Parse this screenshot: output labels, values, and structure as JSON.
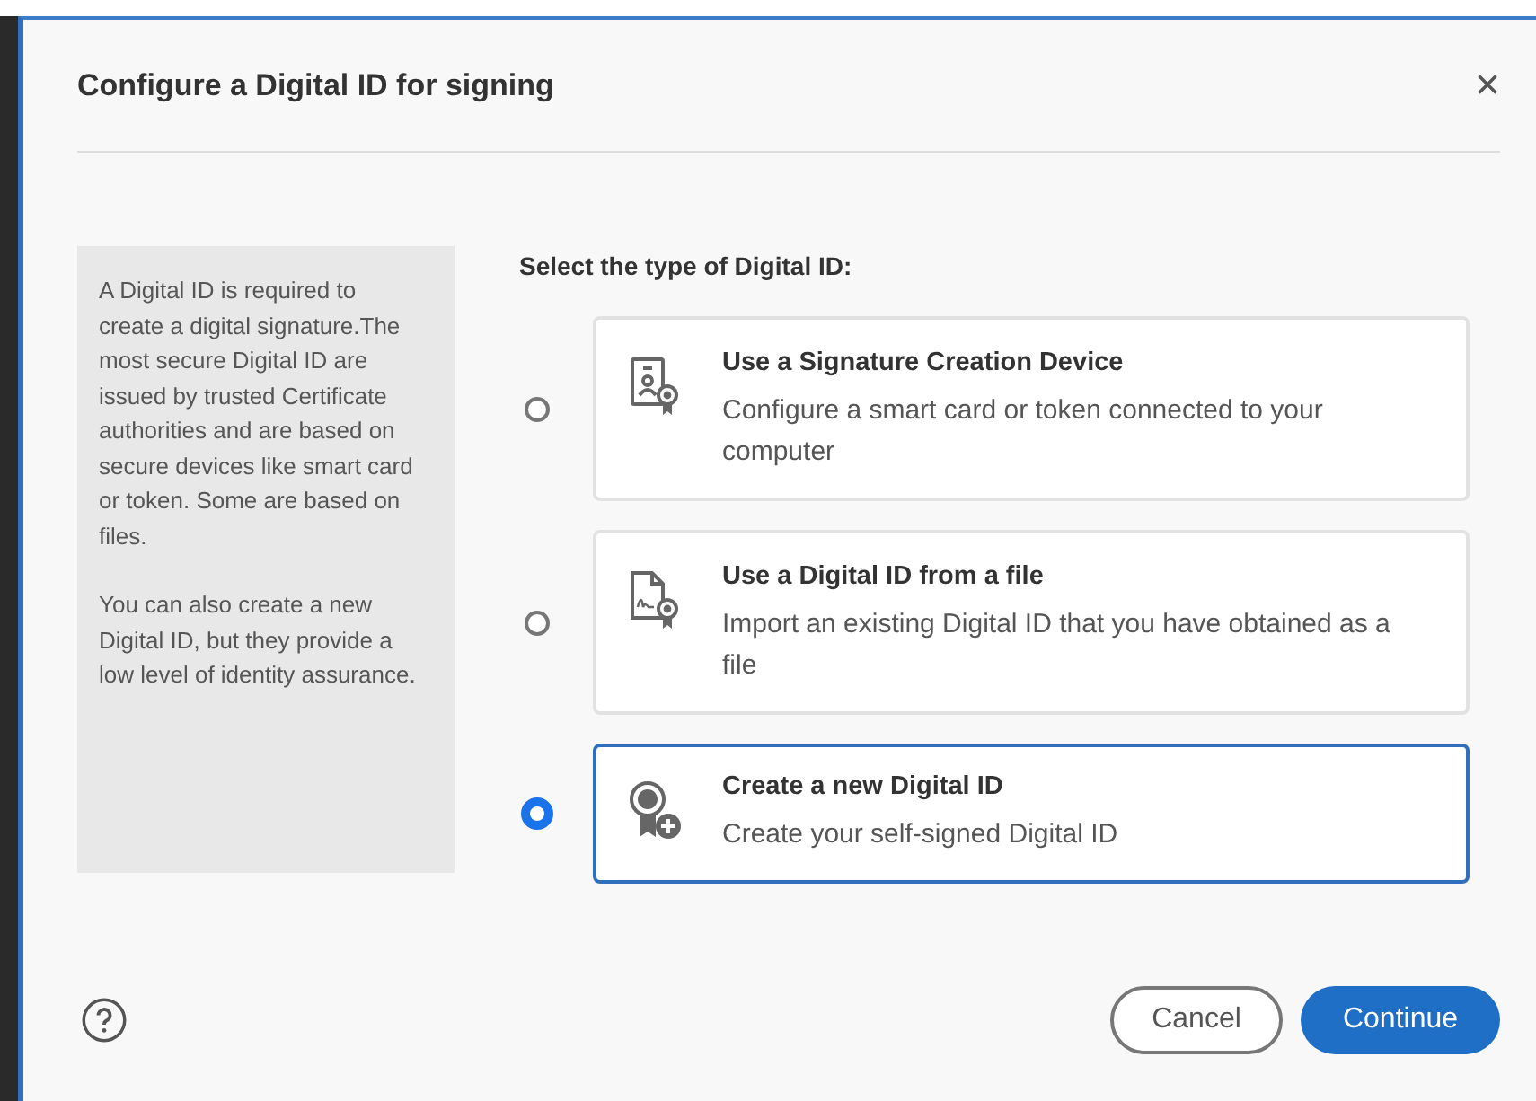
{
  "dialog": {
    "title": "Configure a Digital ID for signing",
    "close": "×"
  },
  "info_panel": {
    "paragraphs": [
      "A Digital ID is required to create a digital signature.The most secure Digital ID are issued by trusted Certificate authorities and are based on secure devices like smart card or token. Some are based on files.",
      "You can also create a new Digital ID, but they provide a low level of identity assurance."
    ]
  },
  "prompt": "Select the type of Digital ID:",
  "options": [
    {
      "kind": "device",
      "title": "Use a Signature Creation Device",
      "description": "Configure a smart card or token connected to your computer",
      "selected": false
    },
    {
      "kind": "file",
      "title": "Use a Digital ID from a file",
      "description": "Import an existing Digital ID that you have obtained as a file",
      "selected": false
    },
    {
      "kind": "new",
      "title": "Create a new Digital ID",
      "description": "Create your self-signed Digital ID",
      "selected": true
    }
  ],
  "buttons": [
    {
      "label": "Cancel",
      "kind": "secondary"
    },
    {
      "label": "Continue",
      "kind": "primary"
    }
  ]
}
